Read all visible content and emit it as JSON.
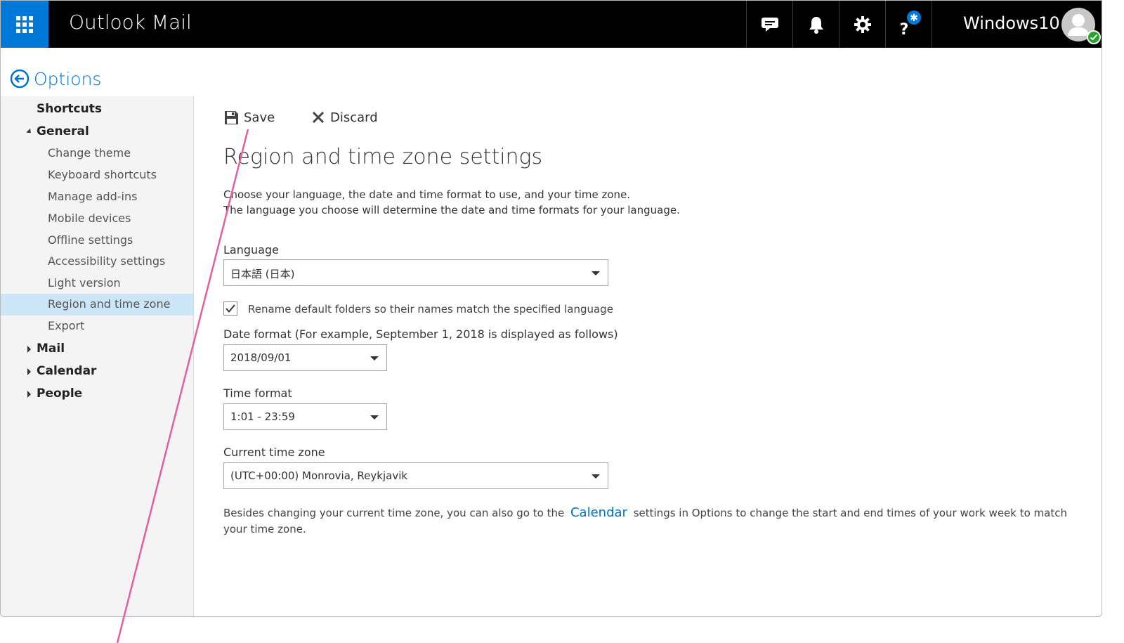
{
  "header": {
    "app_title": "Outlook Mail",
    "user_name": "Windows10",
    "icons": [
      "waffle-icon",
      "chat-icon",
      "bell-icon",
      "gear-icon",
      "help-icon"
    ]
  },
  "options": {
    "title": "Options"
  },
  "sidebar": {
    "items": [
      {
        "label": "Shortcuts",
        "level": "top"
      },
      {
        "label": "General",
        "level": "top",
        "expanded": true
      },
      {
        "label": "Change theme",
        "level": "sub"
      },
      {
        "label": "Keyboard shortcuts",
        "level": "sub"
      },
      {
        "label": "Manage add-ins",
        "level": "sub"
      },
      {
        "label": "Mobile devices",
        "level": "sub"
      },
      {
        "label": "Offline settings",
        "level": "sub"
      },
      {
        "label": "Accessibility settings",
        "level": "sub"
      },
      {
        "label": "Light version",
        "level": "sub"
      },
      {
        "label": "Region and time zone",
        "level": "sub",
        "selected": true
      },
      {
        "label": "Export",
        "level": "sub"
      },
      {
        "label": "Mail",
        "level": "top",
        "expanded": false
      },
      {
        "label": "Calendar",
        "level": "top",
        "expanded": false
      },
      {
        "label": "People",
        "level": "top",
        "expanded": false
      }
    ]
  },
  "toolbar": {
    "save_label": "Save",
    "discard_label": "Discard"
  },
  "main": {
    "title": "Region and time zone settings",
    "description_line1": "Choose your language, the date and time format to use, and your time zone.",
    "description_line2": "The language you choose will determine the date and time formats for your language.",
    "language_label": "Language",
    "language_value": "日本語 (日本)",
    "rename_checkbox_label": "Rename default folders so their names match the specified language",
    "rename_checked": true,
    "date_format_label": "Date format (For example, September 1, 2018 is displayed as follows)",
    "date_format_value": "2018/09/01",
    "time_format_label": "Time format",
    "time_format_value": "1:01 - 23:59",
    "time_zone_label": "Current time zone",
    "time_zone_value": "(UTC+00:00) Monrovia, Reykjavik",
    "footer_before": "Besides changing your current time zone, you can also go to the",
    "footer_link": "Calendar",
    "footer_after": "settings in Options to change the start and end times of your work week to match your time zone."
  },
  "colors": {
    "accent": "#0078d7",
    "link": "#0072c6",
    "topbar": "#000000",
    "selected_bg": "#cde6f7",
    "annotation_line": "#e0619e"
  }
}
